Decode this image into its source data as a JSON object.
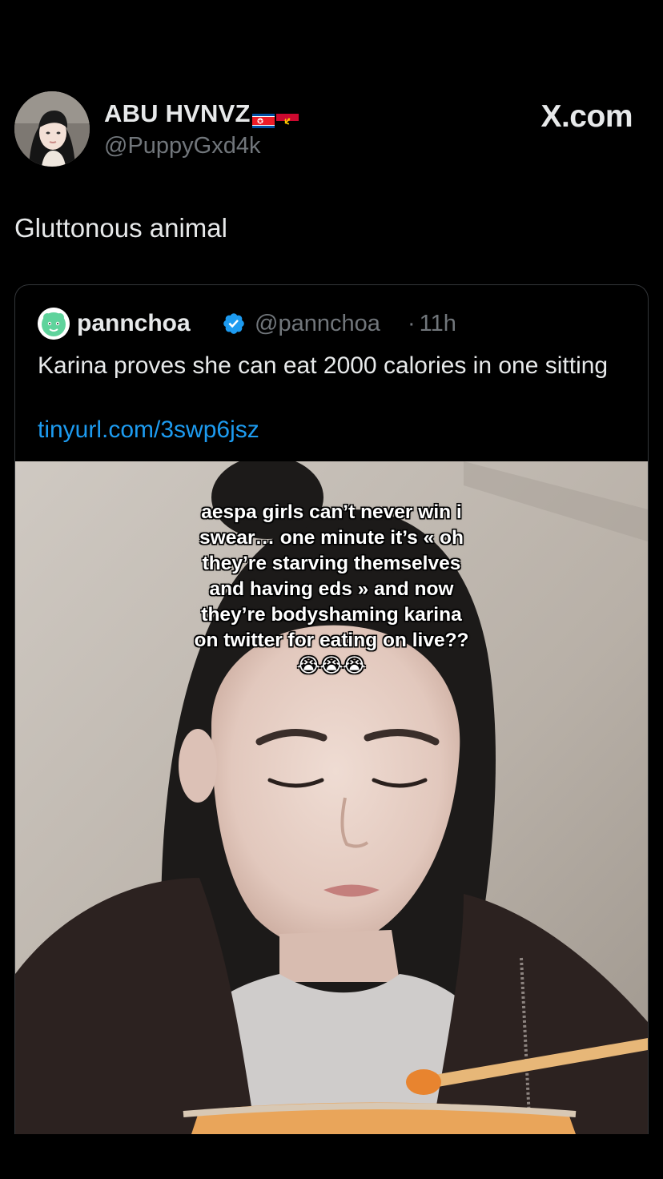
{
  "brand": {
    "label": "X.com"
  },
  "tweet": {
    "author": {
      "display_name": "ABU HVNVZ",
      "handle": "@PuppyGxd4k",
      "flags": [
        "north-korea-flag",
        "angola-flag"
      ]
    },
    "text": "Gluttonous animal"
  },
  "quoted_tweet": {
    "author": {
      "display_name": "pannchoa",
      "handle": "@pannchoa",
      "verified": true
    },
    "separator": "·",
    "time": "11h",
    "text": "Karina proves she can eat 2000 calories in one sitting",
    "link": "tinyurl.com/3swp6jsz",
    "media": {
      "overlay_caption": "aespa girls can’t never win i swear… one minute it’s « oh they’re starving themselves and having eds » and now they’re bodyshaming karina on twitter for eating on live?? 😭😭😭"
    }
  },
  "colors": {
    "background": "#000000",
    "text_primary": "#e7e9ea",
    "text_secondary": "#71767b",
    "link": "#1d9bf0",
    "verified_badge": "#1d9bf0",
    "card_border": "#333639"
  }
}
